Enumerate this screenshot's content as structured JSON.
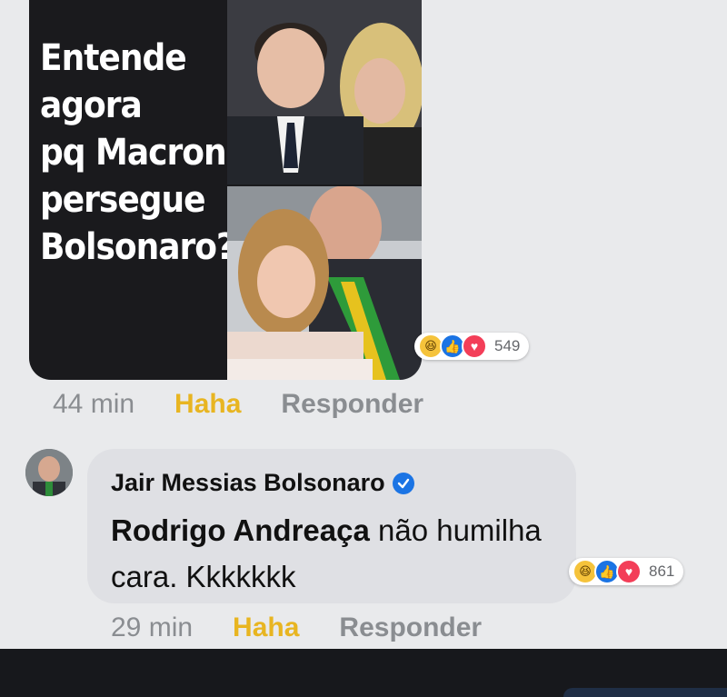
{
  "post": {
    "meme_lines": [
      "Entende",
      "agora",
      "pq Macron",
      "persegue",
      "Bolsonaro?"
    ],
    "reactions": {
      "icons": [
        "haha-icon",
        "like-icon",
        "love-icon"
      ],
      "count": "549"
    },
    "time": "44 min",
    "haha_label": "Haha",
    "reply_label": "Responder"
  },
  "comment": {
    "author": "Jair Messias Bolsonaro",
    "mention": "Rodrigo Andreaça",
    "text_after_mention": " não humilha cara. Kkkkkkk",
    "reactions": {
      "icons": [
        "haha-icon",
        "like-icon",
        "love-icon"
      ],
      "count": "861"
    },
    "time": "29 min",
    "haha_label": "Haha",
    "reply_label": "Responder"
  },
  "colors": {
    "background": "#e9eaec",
    "bubble": "#dfe0e4",
    "haha_link": "#e8b521",
    "like": "#1b74e4",
    "love": "#f33e58"
  }
}
